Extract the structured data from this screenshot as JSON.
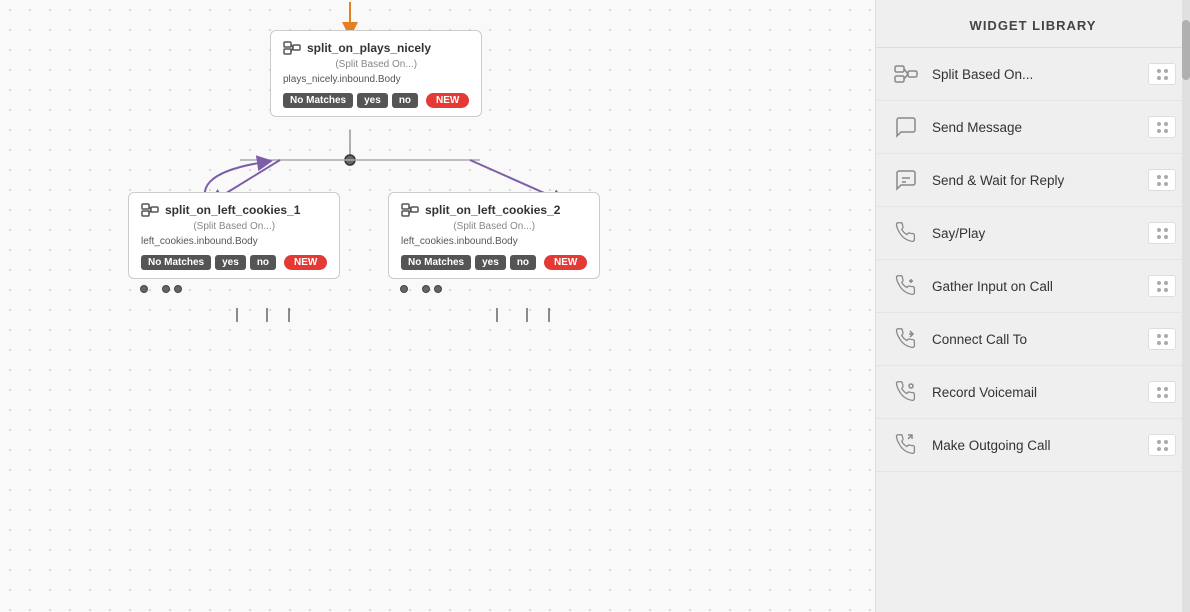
{
  "sidebar": {
    "header": "WIDGET LIBRARY",
    "widgets": [
      {
        "id": "split-based-on",
        "label": "Split Based On...",
        "icon": "split"
      },
      {
        "id": "send-message",
        "label": "Send Message",
        "icon": "message"
      },
      {
        "id": "send-wait-reply",
        "label": "Send & Wait for Reply",
        "icon": "message-wait"
      },
      {
        "id": "say-play",
        "label": "Say/Play",
        "icon": "phone-audio"
      },
      {
        "id": "gather-input-call",
        "label": "Gather Input on Call",
        "icon": "phone-input"
      },
      {
        "id": "connect-call-to",
        "label": "Connect Call To",
        "icon": "phone-connect"
      },
      {
        "id": "record-voicemail",
        "label": "Record Voicemail",
        "icon": "phone-record"
      },
      {
        "id": "make-outgoing-call",
        "label": "Make Outgoing Call",
        "icon": "phone-outgoing"
      }
    ]
  },
  "canvas": {
    "main_node": {
      "id": "split_on_plays_nicely",
      "label": "split_on_plays_nicely",
      "subtitle": "(Split Based On...)",
      "body": "plays_nicely.inbound.Body",
      "badges": [
        "No Matches",
        "yes",
        "no"
      ],
      "has_new": true
    },
    "child_nodes": [
      {
        "id": "split_on_left_cookies_1",
        "label": "split_on_left_cookies_1",
        "subtitle": "(Split Based On...)",
        "body": "left_cookies.inbound.Body",
        "badges": [
          "No Matches",
          "yes",
          "no"
        ],
        "has_new": true
      },
      {
        "id": "split_on_left_cookies_2",
        "label": "split_on_left_cookies_2",
        "subtitle": "(Split Based On...)",
        "body": "left_cookies.inbound.Body",
        "badges": [
          "No Matches",
          "yes",
          "no"
        ],
        "has_new": true
      }
    ]
  }
}
